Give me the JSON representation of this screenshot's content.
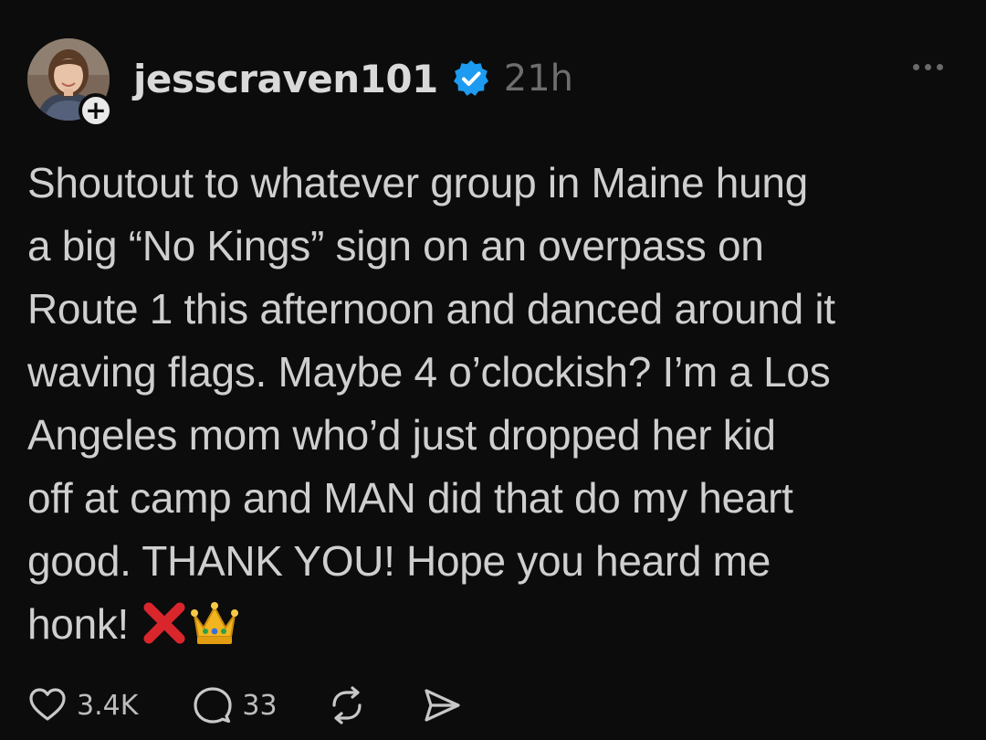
{
  "post": {
    "username": "jesscraven101",
    "timestamp": "21h",
    "follow_symbol": "+",
    "text_lines": [
      "Shoutout to whatever group in Maine hung",
      "a big “No Kings” sign on an overpass on",
      "Route 1 this afternoon and danced around it",
      "waving flags. Maybe 4 o’clockish? I’m a Los",
      "Angeles mom who’d just dropped her kid",
      "off at camp and MAN did that do my heart",
      "good.  THANK YOU! Hope you heard me",
      "honk!"
    ],
    "trailing_emojis": [
      "cross-mark-emoji",
      "crown-emoji"
    ]
  },
  "actions": {
    "likes": "3.4K",
    "replies": "33"
  },
  "icons": {
    "verified": "verified-badge-icon",
    "more": "more-options-icon",
    "like": "heart-icon",
    "reply": "comment-bubble-icon",
    "repost": "repost-icon",
    "share": "send-icon"
  },
  "colors": {
    "background": "#0c0c0c",
    "verified_blue": "#1d9bf0",
    "text": "#cfcfcf",
    "muted": "#6e6e6e"
  }
}
